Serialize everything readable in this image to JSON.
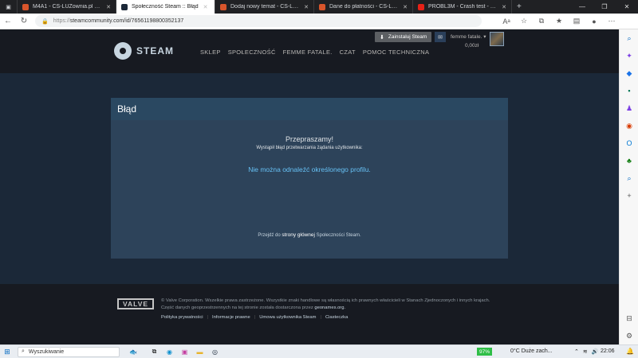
{
  "browser": {
    "tabs": [
      {
        "title": "M4A1 - CS-LUZownia.pl - Sieć Se",
        "favicon_color": "#d9552b",
        "active": false
      },
      {
        "title": "Społeczność Steam :: Błąd",
        "favicon_color": "#1b2838",
        "active": true
      },
      {
        "title": "Dodaj nowy temat - CS-LUZowni",
        "favicon_color": "#d9552b",
        "active": false
      },
      {
        "title": "Dane do płatności - CS-Luzowni",
        "favicon_color": "#d9552b",
        "active": false
      },
      {
        "title": "PROBL3M - Crash test - You",
        "favicon_color": "#e62117",
        "active": false
      }
    ],
    "url_proto": "https://",
    "url_rest": "steamcommunity.com/id/76561198800352137"
  },
  "steam": {
    "install_label": "Zainstaluj Steam",
    "user_name": "femme fatale.",
    "wallet": "0,00zł",
    "logo_text": "STEAM",
    "menu": [
      "SKLEP",
      "SPOŁECZNOŚĆ",
      "FEMME FATALE.",
      "CZAT",
      "POMOC TECHNICZNA"
    ]
  },
  "error": {
    "heading": "Błąd",
    "sorry": "Przepraszamy!",
    "sub": "Wystąpił błąd przetwarzania żądania użytkownika:",
    "message": "Nie można odnaleźć określonego profilu.",
    "goto_prefix": "Przejdź do",
    "goto_link": "strony głównej",
    "goto_suffix": "Społeczności Steam."
  },
  "footer": {
    "valve": "VALVE",
    "legal": "© Valve Corporation. Wszelkie prawa zastrzeżone. Wszystkie znaki handlowe są własnością ich prawnych właścicieli w Stanach Zjednoczonych i innych krajach. Część danych geoprzestrzennych na tej stronie została dostarczona przez",
    "geo": "geonames.org.",
    "links": [
      "Polityka prywatności",
      "Informacje prawne",
      "Umowa użytkownika Steam",
      "Ciasteczka"
    ]
  },
  "taskbar": {
    "search_placeholder": "Wyszukiwanie",
    "battery": "97%",
    "weather": "0°C  Duże zach...",
    "time": "22:06"
  }
}
